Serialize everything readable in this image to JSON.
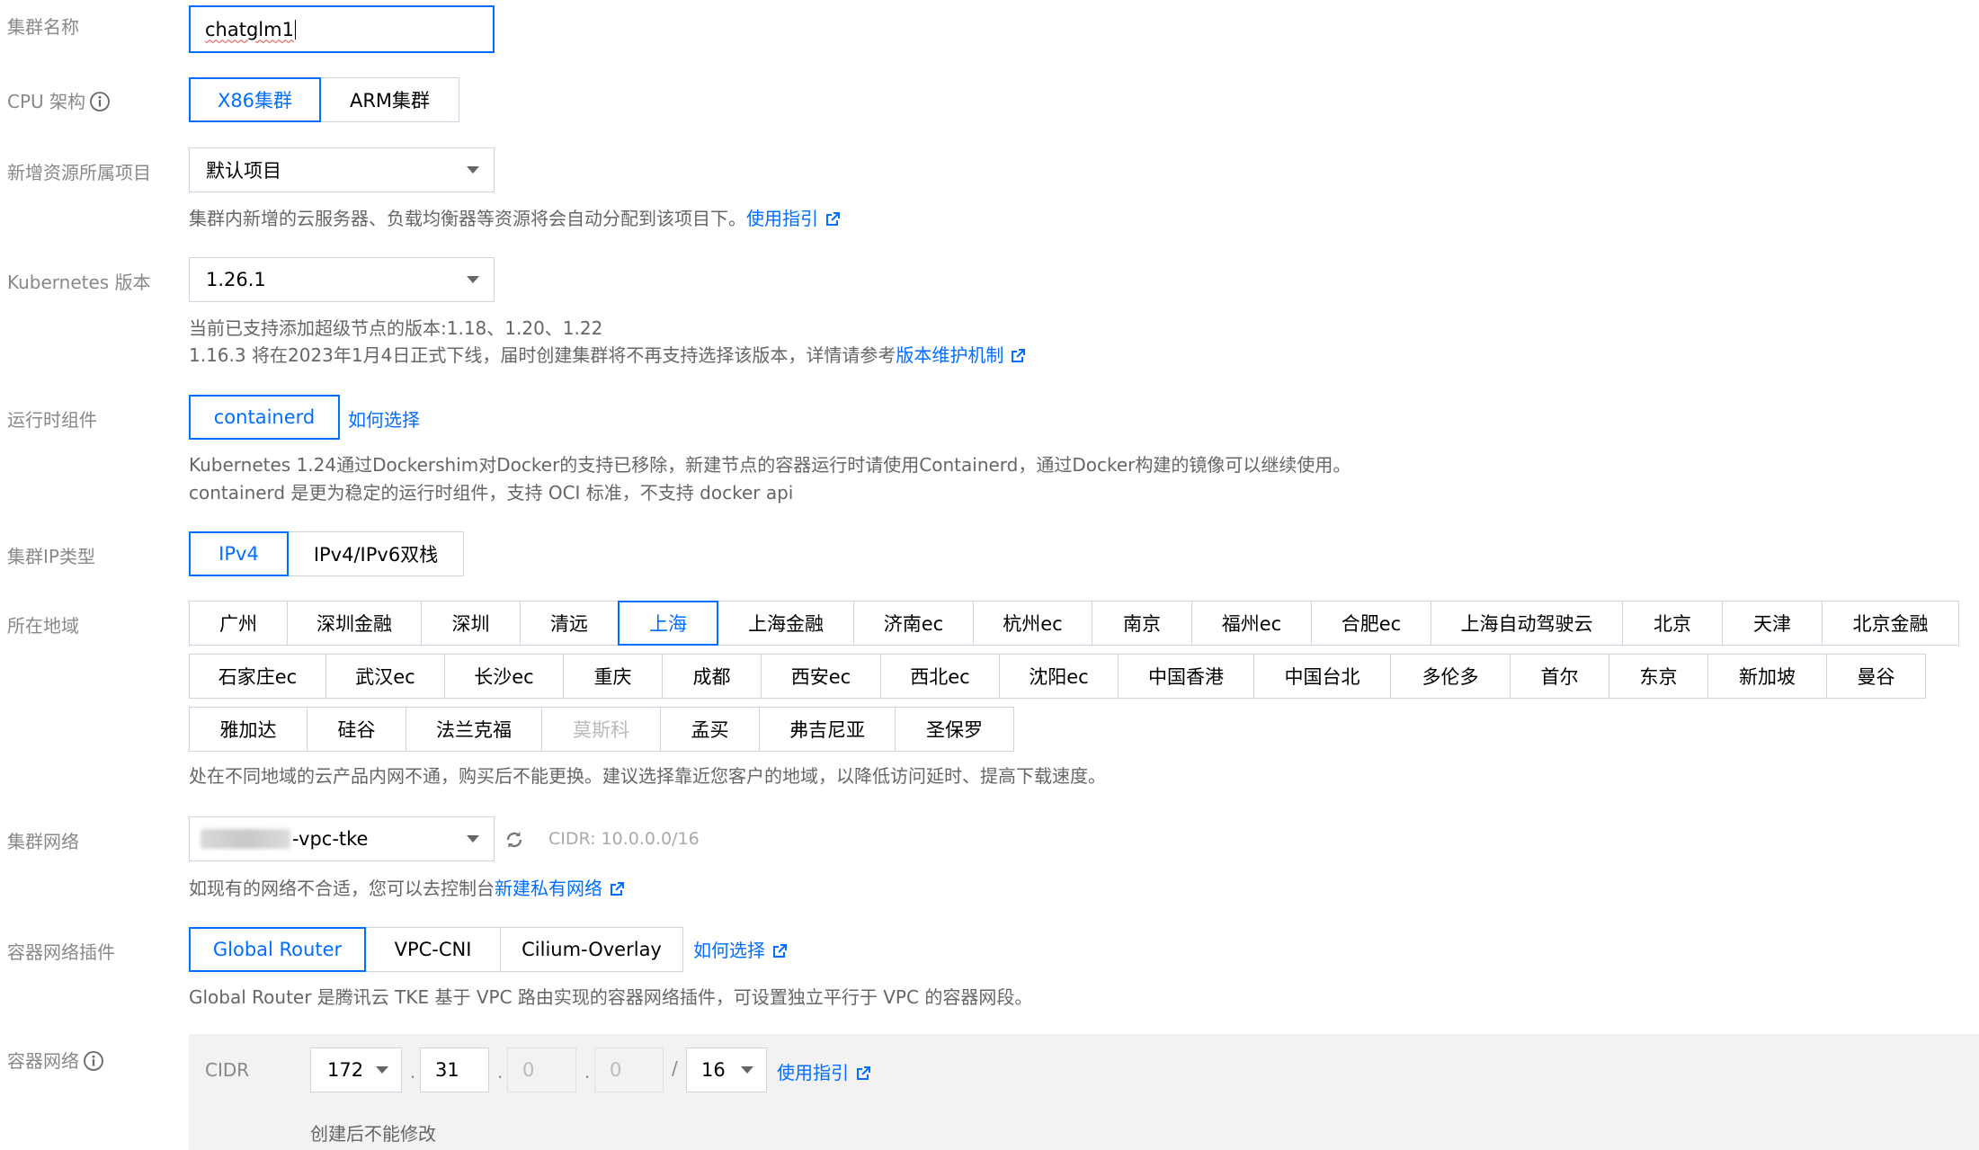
{
  "cluster_name": {
    "label": "集群名称",
    "value": "chatglm1"
  },
  "cpu_arch": {
    "label": "CPU 架构",
    "options": [
      "X86集群",
      "ARM集群"
    ],
    "selected": "X86集群"
  },
  "project": {
    "label": "新增资源所属项目",
    "value": "默认项目",
    "help_text": "集群内新增的云服务器、负载均衡器等资源将会自动分配到该项目下。",
    "help_link": "使用指引"
  },
  "k8s_version": {
    "label": "Kubernetes 版本",
    "value": "1.26.1",
    "help_line1": "当前已支持添加超级节点的版本:1.18、1.20、1.22",
    "help_line2": "1.16.3 将在2023年1月4日正式下线，届时创建集群将不再支持选择该版本，详情请参考",
    "help_link": "版本维护机制"
  },
  "runtime": {
    "label": "运行时组件",
    "options": [
      "containerd"
    ],
    "selected": "containerd",
    "how_link": "如何选择",
    "help_line1": "Kubernetes 1.24通过Dockershim对Docker的支持已移除，新建节点的容器运行时请使用Containerd，通过Docker构建的镜像可以继续使用。",
    "help_line2": "containerd 是更为稳定的运行时组件，支持 OCI 标准，不支持 docker api"
  },
  "ip_type": {
    "label": "集群IP类型",
    "options": [
      "IPv4",
      "IPv4/IPv6双栈"
    ],
    "selected": "IPv4"
  },
  "region": {
    "label": "所在地域",
    "selected": "上海",
    "disabled": [
      "莫斯科"
    ],
    "row1": [
      "广州",
      "深圳金融",
      "深圳",
      "清远",
      "上海",
      "上海金融",
      "济南ec",
      "杭州ec",
      "南京",
      "福州ec",
      "合肥ec",
      "上海自动驾驶云",
      "北京",
      "天津",
      "北京金融"
    ],
    "row2": [
      "石家庄ec",
      "武汉ec",
      "长沙ec",
      "重庆",
      "成都",
      "西安ec",
      "西北ec",
      "沈阳ec",
      "中国香港",
      "中国台北",
      "多伦多",
      "首尔",
      "东京",
      "新加坡",
      "曼谷"
    ],
    "row3": [
      "雅加达",
      "硅谷",
      "法兰克福",
      "莫斯科",
      "孟买",
      "弗吉尼亚",
      "圣保罗"
    ],
    "help_text": "处在不同地域的云产品内网不通，购买后不能更换。建议选择靠近您客户的地域，以降低访问延时、提高下载速度。"
  },
  "vpc": {
    "label": "集群网络",
    "value": "-vpc-tke",
    "cidr": "CIDR: 10.0.0.0/16",
    "help_text": "如现有的网络不合适，您可以去控制台",
    "help_link": "新建私有网络"
  },
  "network_plugin": {
    "label": "容器网络插件",
    "options": [
      "Global Router",
      "VPC-CNI",
      "Cilium-Overlay"
    ],
    "selected": "Global Router",
    "how_link": "如何选择",
    "help_text": "Global Router 是腾讯云 TKE 基于 VPC 路由实现的容器网络插件，可设置独立平行于 VPC 的容器网段。"
  },
  "container_network": {
    "label": "容器网络",
    "cidr_label": "CIDR",
    "octet1": "172",
    "octet2": "31",
    "octet3": "0",
    "octet4": "0",
    "separator_dot": ".",
    "separator_slash": "/",
    "mask": "16",
    "help_link": "使用指引",
    "note": "创建后不能修改"
  },
  "colors": {
    "accent": "#006eff",
    "border": "#cfd5de",
    "label": "#888888",
    "panel_bg": "#f2f2f2"
  }
}
